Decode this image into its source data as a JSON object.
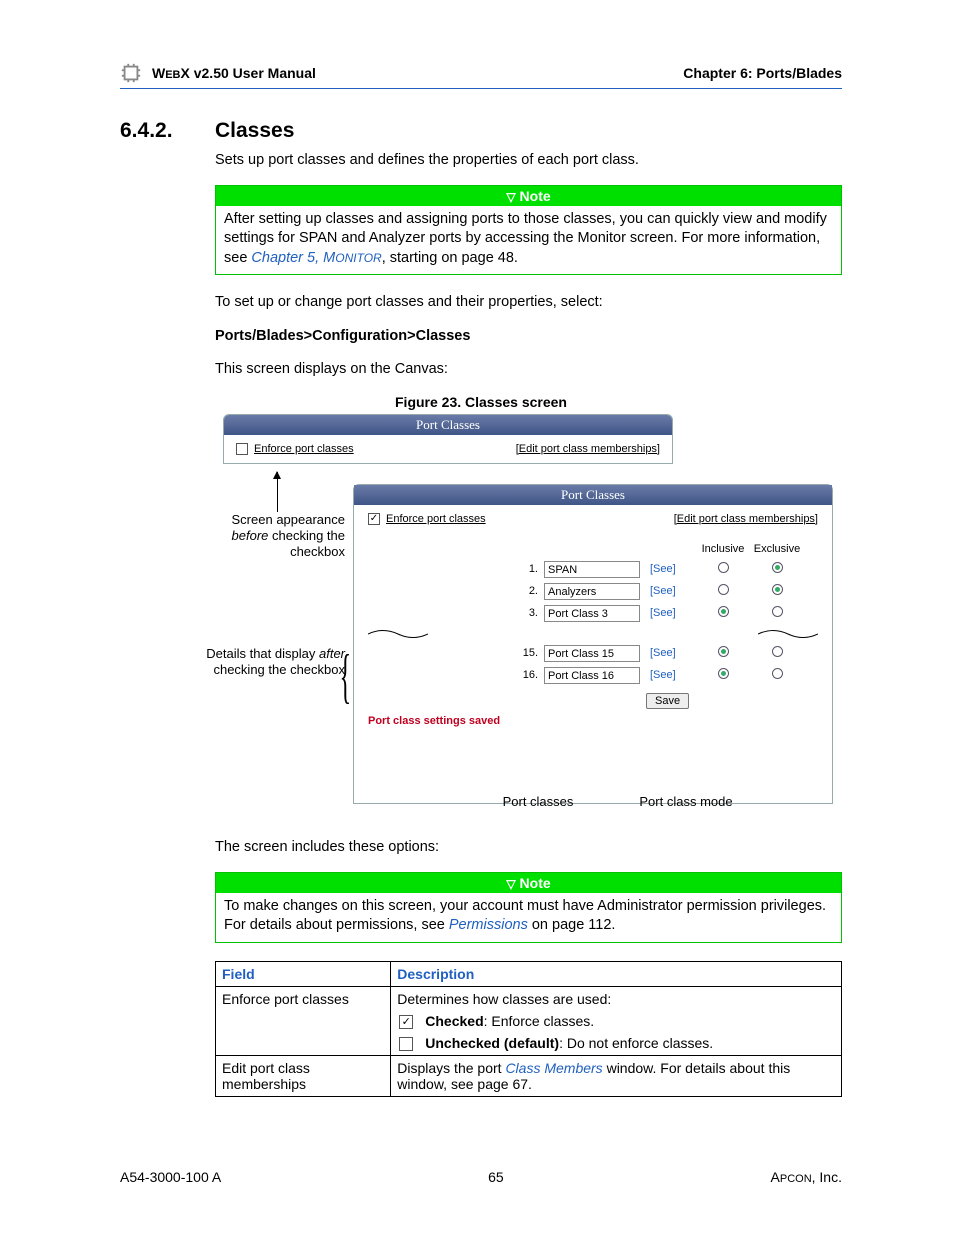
{
  "header": {
    "product_prefix": "W",
    "product_mid": "EB",
    "product_rest": "X v2.50 User Manual",
    "chapter": "Chapter 6: Ports/Blades"
  },
  "section": {
    "number": "6.4.2.",
    "title": "Classes"
  },
  "intro": "Sets up port classes and defines the properties of each port class.",
  "note1": {
    "label": "Note",
    "pre": "After setting up classes and assigning ports to those classes, you can quickly view and modify settings for SPAN and Analyzer ports by accessing the Monitor screen. For more information, see ",
    "link": "Chapter 5, M",
    "link_sc": "ONITOR",
    "post": ", starting on page 48."
  },
  "setup_line": "To set up or change port classes and their properties, select:",
  "breadcrumb": "Ports/Blades>Configuration>Classes",
  "canvas_line": "This screen displays on the Canvas:",
  "figure_caption": "Figure 23. Classes screen",
  "screenshot": {
    "panel_title": "Port Classes",
    "enforce_label": "Enforce port classes",
    "edit_link": "[Edit port class memberships]",
    "col_inclusive": "Inclusive",
    "col_exclusive": "Exclusive",
    "rows": [
      {
        "n": "1.",
        "name": "SPAN",
        "see": "[See]",
        "inc": false,
        "exc": true
      },
      {
        "n": "2.",
        "name": "Analyzers",
        "see": "[See]",
        "inc": false,
        "exc": true
      },
      {
        "n": "3.",
        "name": "Port Class 3",
        "see": "[See]",
        "inc": true,
        "exc": false
      }
    ],
    "rows2": [
      {
        "n": "15.",
        "name": "Port Class 15",
        "see": "[See]",
        "inc": true,
        "exc": false
      },
      {
        "n": "16.",
        "name": "Port Class 16",
        "see": "[See]",
        "inc": true,
        "exc": false
      }
    ],
    "save": "Save",
    "saved_msg": "Port class settings saved",
    "annot_before": "Screen appearance before checking the checkbox",
    "annot_before_em": "before",
    "annot_after_pre": "Details that display",
    "annot_after_em": "after",
    "annot_after_post": " checking the checkbox",
    "cap_classes": "Port classes",
    "cap_mode": "Port class mode"
  },
  "options_line": "The screen includes these options:",
  "note2": {
    "label": "Note",
    "pre": "To make changes on this screen, your account must have Administrator permission privileges. For details about permissions, see ",
    "link": "Permissions",
    "post": " on page 112."
  },
  "table": {
    "h1": "Field",
    "h2": "Description",
    "r1f": "Enforce port classes",
    "r1d": "Determines how classes are used:",
    "r1c": "Checked",
    "r1c_post": ": Enforce classes.",
    "r1u": "Unchecked (default)",
    "r1u_post": ": Do not enforce classes.",
    "r2f": "Edit port class memberships",
    "r2d_pre": "Displays the port ",
    "r2d_link": "Class Members",
    "r2d_post": " window. For details about this window, see page 67."
  },
  "footer": {
    "left": "A54-3000-100 A",
    "center": "65",
    "right_pre": "A",
    "right_sc": "PCON",
    "right_post": ", Inc."
  }
}
